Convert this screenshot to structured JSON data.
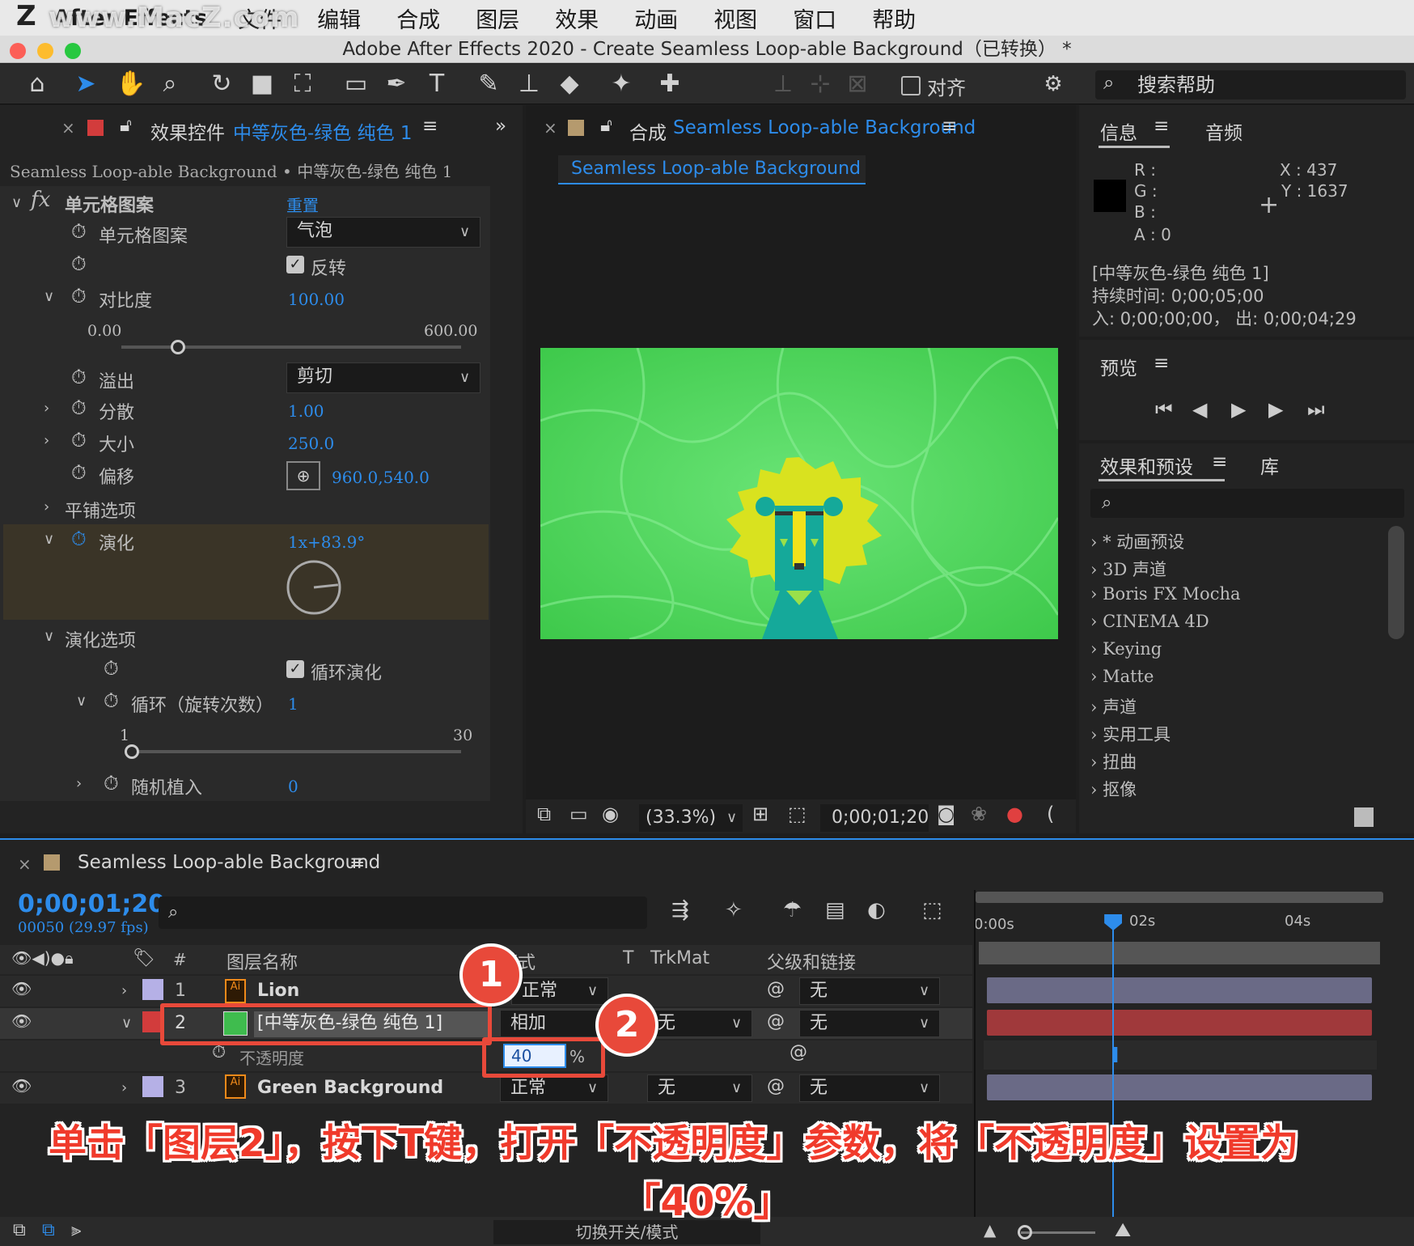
{
  "watermark": "www.MacZ.com",
  "menubar": {
    "app": "After Effects",
    "items": [
      "文件",
      "编辑",
      "合成",
      "图层",
      "效果",
      "动画",
      "视图",
      "窗口",
      "帮助"
    ]
  },
  "window_title": "Adobe After Effects 2020 - Create Seamless Loop-able Background（已转换） *",
  "toolbar": {
    "align_label": "对齐",
    "search_placeholder": "搜索帮助"
  },
  "effect_controls": {
    "tab_prefix": "效果控件",
    "tab_layer": "中等灰色-绿色 纯色 1",
    "breadcrumb": "Seamless Loop-able Background • 中等灰色-绿色 纯色 1",
    "effect_name": "单元格图案",
    "reset": "重置",
    "props": {
      "pattern_label": "单元格图案",
      "pattern_value": "气泡",
      "invert_label": "反转",
      "contrast_label": "对比度",
      "contrast_value": "100.00",
      "contrast_min": "0.00",
      "contrast_max": "600.00",
      "contrast_fraction": 0.167,
      "overflow_label": "溢出",
      "overflow_value": "剪切",
      "disperse_label": "分散",
      "disperse_value": "1.00",
      "size_label": "大小",
      "size_value": "250.0",
      "offset_label": "偏移",
      "offset_value": "960.0,540.0",
      "tiling_label": "平铺选项",
      "evolution_label": "演化",
      "evolution_value": "1x+83.9°",
      "evolution_angle": 83.9,
      "evo_options_label": "演化选项",
      "cycle_label": "循环演化",
      "loop_label": "循环（旋转次数）",
      "loop_value": "1",
      "loop_min": "1",
      "loop_max": "30",
      "random_label": "随机植入",
      "random_value": "0"
    }
  },
  "composition": {
    "tab_prefix": "合成",
    "tab_name": "Seamless Loop-able Background",
    "subtab": "Seamless Loop-able Background",
    "zoom": "(33.3%)",
    "timecode": "0;00;01;20",
    "colors": {
      "bg": "#4fd45a",
      "mane": "#d9e21f",
      "face": "#15a99a",
      "nose": "#f2e21a"
    }
  },
  "info_panel": {
    "tab_info": "信息",
    "tab_audio": "音频",
    "r": "R :",
    "g": "G :",
    "b": "B :",
    "a": "A :  0",
    "x": "X : 437",
    "y": "Y : 1637",
    "layer": "[中等灰色-绿色 纯色 1]",
    "duration": "持续时间: 0;00;05;00",
    "inout": "入: 0;00;00;00，  出: 0;00;04;29"
  },
  "preview_panel": {
    "title": "预览"
  },
  "effects_presets": {
    "tab": "效果和预设",
    "tab_lib": "库",
    "items": [
      "* 动画预设",
      "3D 声道",
      "Boris FX Mocha",
      "CINEMA 4D",
      "Keying",
      "Matte",
      "声道",
      "实用工具",
      "扭曲",
      "抠像"
    ]
  },
  "timeline": {
    "tab": "Seamless Loop-able Background",
    "timecode": "0;00;01;20",
    "frames": "00050 (29.97 fps)",
    "col_num": "#",
    "col_name": "图层名称",
    "col_mode": "模式",
    "col_t": "T",
    "col_trkmat": "TrkMat",
    "col_parent": "父级和链接",
    "ruler": [
      "0:00s",
      "02s",
      "04s"
    ],
    "playhead_fraction": 0.333,
    "layers": [
      {
        "num": "1",
        "name": "Lion",
        "mode": "正常",
        "trkmat": "",
        "parent": "无",
        "label": "#b5b0e6",
        "bar": "#6a6a86"
      },
      {
        "num": "2",
        "name": "[中等灰色-绿色 纯色 1]",
        "mode": "相加",
        "trkmat": "无",
        "parent": "无",
        "label": "#d23c3c",
        "bar": "#a0393b"
      },
      {
        "num": "3",
        "name": "Green Background",
        "mode": "正常",
        "trkmat": "无",
        "parent": "无",
        "label": "#b5b0e6",
        "bar": "#6a6a86"
      }
    ],
    "opacity_label": "不透明度",
    "opacity_value": "40",
    "opacity_unit": "%",
    "footer": "切换开关/模式"
  },
  "annotation": {
    "badge1": "1",
    "badge2": "2",
    "caption_line1": "单击「图层2」，按下T键，打开「不透明度」参数，将「不透明度」设置为",
    "caption_line2": "「40%」"
  }
}
